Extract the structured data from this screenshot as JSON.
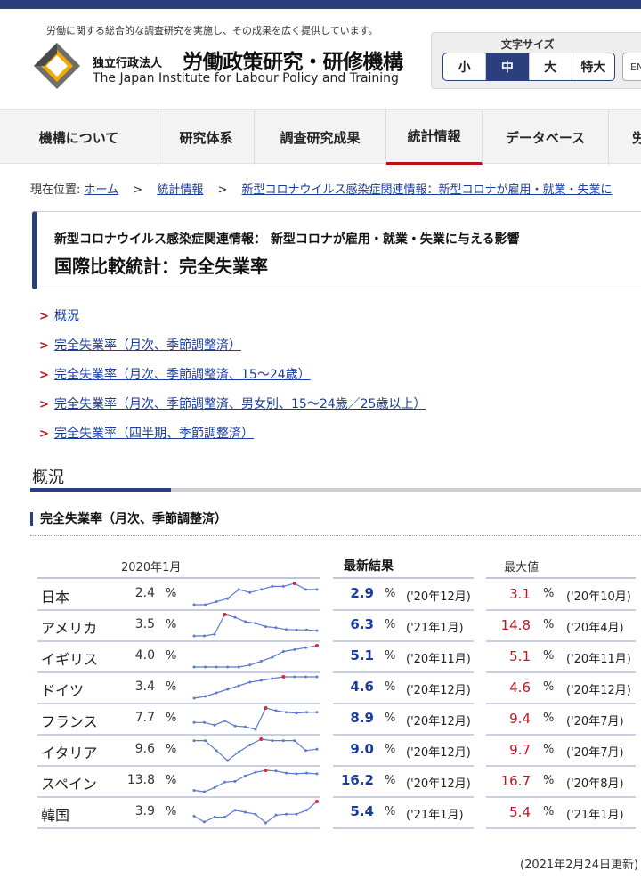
{
  "header": {
    "tagline": "労働に関する総合的な調査研究を実施し、その成果を広く提供しています。",
    "org_prefix": "独立行政法人",
    "org_name": "労働政策研究・研修機構",
    "org_name_en": "The Japan Institute for Labour Policy and Training",
    "font_size_title": "文字サイズ",
    "font_sizes": [
      "小",
      "中",
      "大",
      "特大"
    ],
    "font_size_selected": "中",
    "lang_button": "EN"
  },
  "nav": {
    "items": [
      "機構について",
      "研究体系",
      "調査研究成果",
      "統計情報",
      "データベース",
      "労"
    ],
    "active": "統計情報"
  },
  "breadcrumb": {
    "label": "現在位置:",
    "items": [
      "ホーム",
      "統計情報",
      "新型コロナウイルス感染症関連情報：新型コロナが雇用・就業・失業に"
    ],
    "separator": ">"
  },
  "page": {
    "subtitle": "新型コロナウイルス感染症関連情報： 新型コロナが雇用・就業・失業に与える影響",
    "title": "国際比較統計：完全失業率"
  },
  "links": [
    "概況",
    "完全失業率（月次、季節調整済）",
    "完全失業率（月次、季節調整済、15～24歳）",
    "完全失業率（月次、季節調整済、男女別、15～24歳／25歳以上）",
    "完全失業率（四半期、季節調整済）"
  ],
  "section": {
    "heading": "概況",
    "table_heading": "完全失業率（月次、季節調整済）"
  },
  "table": {
    "col_base": "2020年1月",
    "col_latest": "最新結果",
    "col_max": "最大値",
    "unit": "%",
    "rows": [
      {
        "country": "日本",
        "base": "2.4",
        "latest": "2.9",
        "latest_date": "('20年12月)",
        "max": "3.1",
        "max_date": "('20年10月)",
        "trend": [
          2.4,
          2.4,
          2.5,
          2.6,
          2.9,
          2.8,
          2.9,
          3.0,
          3.0,
          3.1,
          2.9,
          2.9
        ]
      },
      {
        "country": "アメリカ",
        "base": "3.5",
        "latest": "6.3",
        "latest_date": "('21年1月)",
        "max": "14.8",
        "max_date": "('20年4月)",
        "trend": [
          3.5,
          3.5,
          4.4,
          14.8,
          13.3,
          11.1,
          10.2,
          8.4,
          7.9,
          6.9,
          6.7,
          6.7,
          6.3
        ]
      },
      {
        "country": "イギリス",
        "base": "4.0",
        "latest": "5.1",
        "latest_date": "('20年11月)",
        "max": "5.1",
        "max_date": "('20年11月)",
        "trend": [
          4.0,
          4.0,
          4.0,
          4.0,
          4.0,
          4.1,
          4.3,
          4.5,
          4.8,
          4.9,
          5.0,
          5.1
        ]
      },
      {
        "country": "ドイツ",
        "base": "3.4",
        "latest": "4.6",
        "latest_date": "('20年12月)",
        "max": "4.6",
        "max_date": "('20年12月)",
        "trend": [
          3.4,
          3.5,
          3.7,
          3.9,
          4.1,
          4.3,
          4.4,
          4.5,
          4.6,
          4.6,
          4.6,
          4.6
        ]
      },
      {
        "country": "フランス",
        "base": "7.7",
        "latest": "8.9",
        "latest_date": "('20年12月)",
        "max": "9.4",
        "max_date": "('20年7月)",
        "trend": [
          7.7,
          7.7,
          7.4,
          7.9,
          7.3,
          7.2,
          6.9,
          9.4,
          9.1,
          8.9,
          8.8,
          8.9,
          8.9
        ]
      },
      {
        "country": "イタリア",
        "base": "9.6",
        "latest": "9.0",
        "latest_date": "('20年12月)",
        "max": "9.7",
        "max_date": "('20年7月)",
        "trend": [
          9.6,
          9.6,
          8.9,
          8.2,
          8.8,
          9.3,
          9.7,
          9.6,
          9.6,
          9.6,
          8.9,
          9.0
        ]
      },
      {
        "country": "スペイン",
        "base": "13.8",
        "latest": "16.2",
        "latest_date": "('20年12月)",
        "max": "16.7",
        "max_date": "('20年8月)",
        "trend": [
          13.8,
          13.6,
          14.2,
          15.0,
          15.1,
          15.9,
          16.4,
          16.7,
          16.6,
          16.3,
          16.2,
          16.3,
          16.2
        ]
      },
      {
        "country": "韓国",
        "base": "3.9",
        "latest": "5.4",
        "latest_date": "('21年1月)",
        "max": "5.4",
        "max_date": "('21年1月)",
        "trend": [
          3.9,
          3.3,
          3.8,
          3.8,
          4.5,
          4.3,
          4.1,
          3.2,
          4.0,
          4.1,
          4.1,
          4.5,
          5.4
        ]
      }
    ]
  },
  "updated": "(2021年2月24日更新)",
  "colors": {
    "brand": "#2b3f7f",
    "accent": "#b8121b",
    "link": "#1a3c9c",
    "max": "#c0161f",
    "spark": "#5b7bd0"
  }
}
